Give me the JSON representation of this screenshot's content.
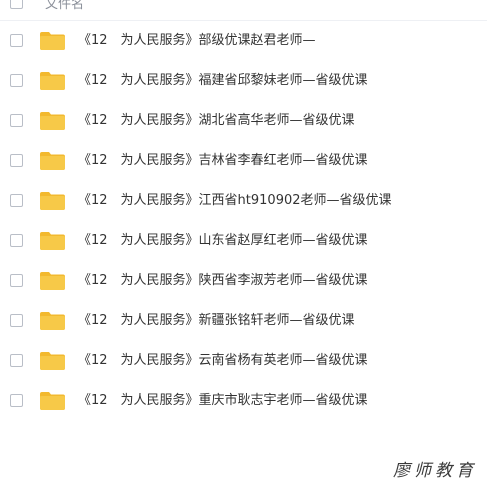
{
  "header": {
    "column_label": "文件名"
  },
  "colors": {
    "folder": "#f7c948",
    "folder_tab": "#f2b92f",
    "text": "#333333",
    "header_text": "#8a8f99"
  },
  "files": [
    {
      "name": "《12　为人民服务》部级优课赵君老师—",
      "icon": "folder-icon"
    },
    {
      "name": "《12　为人民服务》福建省邱黎妹老师—省级优课",
      "icon": "folder-icon"
    },
    {
      "name": "《12　为人民服务》湖北省高华老师—省级优课",
      "icon": "folder-icon"
    },
    {
      "name": "《12　为人民服务》吉林省李春红老师—省级优课",
      "icon": "folder-icon"
    },
    {
      "name": "《12　为人民服务》江西省ht910902老师—省级优课",
      "icon": "folder-icon"
    },
    {
      "name": "《12　为人民服务》山东省赵厚红老师—省级优课",
      "icon": "folder-icon"
    },
    {
      "name": "《12　为人民服务》陕西省李淑芳老师—省级优课",
      "icon": "folder-icon"
    },
    {
      "name": "《12　为人民服务》新疆张铭轩老师—省级优课",
      "icon": "folder-icon"
    },
    {
      "name": "《12　为人民服务》云南省杨有英老师—省级优课",
      "icon": "folder-icon"
    },
    {
      "name": "《12　为人民服务》重庆市耿志宇老师—省级优课",
      "icon": "folder-icon"
    }
  ],
  "watermark": "廖师教育"
}
